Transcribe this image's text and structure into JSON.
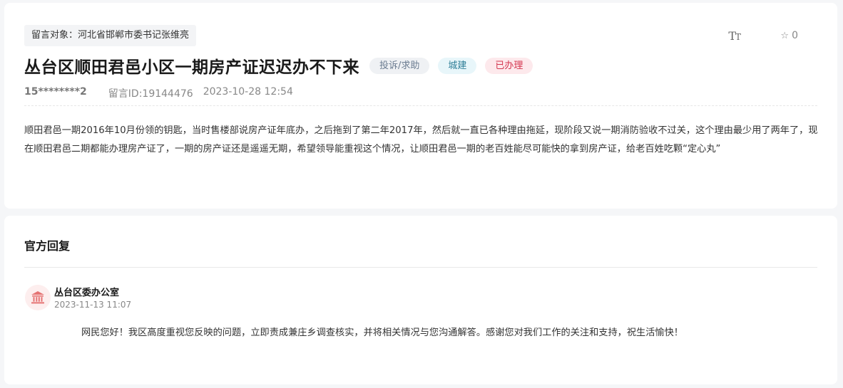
{
  "message": {
    "target_label": "留言对象：河北省邯郸市委书记张维亮",
    "font_tool": {
      "big": "T",
      "small": "T"
    },
    "favorite": {
      "icon": "star-outline-icon",
      "count": "0"
    },
    "title": "丛台区顺田君邑小区一期房产证迟迟办不下来",
    "tags": {
      "type": "投诉/求助",
      "category": "城建",
      "status": "已办理"
    },
    "user": "15********2",
    "message_id": "留言ID:19144476",
    "datetime": "2023-10-28 12:54",
    "content": "顺田君邑一期2016年10月份领的钥匙，当时售楼部说房产证年底办，之后拖到了第二年2017年，然后就一直已各种理由拖延，现阶段又说一期消防验收不过关，这个理由最少用了两年了，现在顺田君邑二期都能办理房产证了，一期的房产证还是遥遥无期，希望领导能重视这个情况，让顺田君邑一期的老百姓能尽可能快的拿到房产证，给老百姓吃颗“定心丸”"
  },
  "reply": {
    "heading": "官方回复",
    "org_icon": "government-building-icon",
    "org_name": "丛台区委办公室",
    "datetime": "2023-11-13 11:07",
    "content": "网民您好！我区高度重视您反映的问题，立即责成兼庄乡调查核实，并将相关情况与您沟通解答。感谢您对我们工作的关注和支持，祝生活愉快！"
  },
  "colors": {
    "status_red": "#d4364f",
    "category_teal": "#2f7f98",
    "icon_red": "#e57373"
  }
}
